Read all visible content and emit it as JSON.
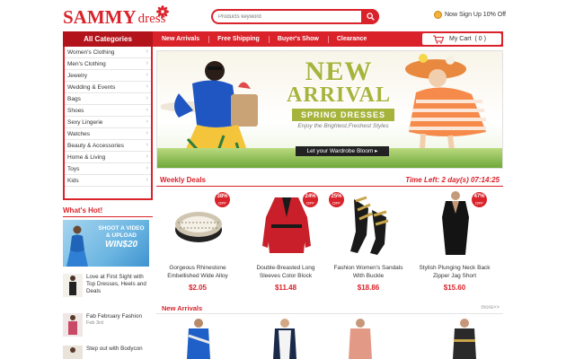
{
  "header": {
    "logo_main": "SAMMY",
    "logo_sub": "dress",
    "search_placeholder": "Products keyword",
    "signup_text": "Now Sign Up 10% Off"
  },
  "nav": {
    "all_categories": "All Categories",
    "items": [
      "New Arrivals",
      "Free Shipping",
      "Buyer's Show",
      "Clearance"
    ],
    "cart_label": "My Cart",
    "cart_count": "( 0 )"
  },
  "categories": [
    "Women's Clothing",
    "Men's Clothing",
    "Jewelry",
    "Wedding & Events",
    "Bags",
    "Shoes",
    "Sexy Lingerie",
    "Watches",
    "Beauty & Accessories",
    "Home & Living",
    "Toys",
    "Kids"
  ],
  "banner": {
    "line1": "NEW",
    "line2": "ARRIVAL",
    "line3": "SPRING DRESSES",
    "tagline": "Enjoy the Brightest,Freshest Styles",
    "button": "Let your Wardrobe Bloom ▸"
  },
  "whats_hot": {
    "title": "What's Hot!",
    "ad_line1": "SHOOT A VIDEO",
    "ad_line2": "& UPLOAD",
    "ad_line3": "WIN$20",
    "items": [
      {
        "text": "Love at First Sight with Top Dresses, Heels and Deals",
        "date": ""
      },
      {
        "text": "Fab February Fashion",
        "date": "Feb 3rd"
      },
      {
        "text": "Step out with Bodycon",
        "date": ""
      }
    ]
  },
  "weekly": {
    "title": "Weekly Deals",
    "time_left": "Time Left: 2 day(s) 07:14:25",
    "products": [
      {
        "name": "Gorgeous Rhinestone Embellished Wide Alloy",
        "price": "$2.05",
        "discount": "38%",
        "off": "OFF"
      },
      {
        "name": "Double-Breasted Long Sleeves Color Block",
        "price": "$11.48",
        "discount": "24%",
        "off": "OFF"
      },
      {
        "name": "Fashion Women's Sandals With Buckle",
        "price": "$18.86",
        "discount": "25%",
        "off": "OFF"
      },
      {
        "name": "Stylish Plunging Neck Back Zipper Jag Short",
        "price": "$15.60",
        "discount": "47%",
        "off": "OFF"
      }
    ]
  },
  "new_arrivals": {
    "title": "New Arrivals",
    "more": "more>>"
  },
  "colors": {
    "brand_red": "#d9222a",
    "dark_red": "#b3141b",
    "banner_green": "#a6b43c"
  }
}
